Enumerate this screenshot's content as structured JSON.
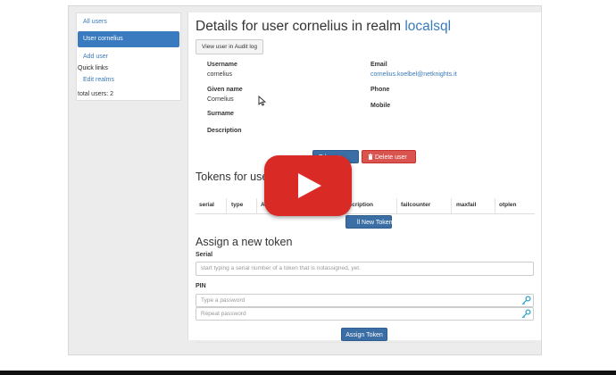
{
  "sidebar": {
    "all_users": "All users",
    "current_user": "User cornelius",
    "add_user": "Add user",
    "quick_links_title": "Quick links",
    "edit_realms": "Edit realms",
    "total_users": "total users: 2"
  },
  "header": {
    "title_prefix": "Details for user cornelius in realm",
    "realm": "localsql",
    "audit_button": "View user in Audit log"
  },
  "user_fields": {
    "username_label": "Username",
    "username_value": "cornelius",
    "email_label": "Email",
    "email_value": "cornelius.koelbel@netknights.it",
    "given_name_label": "Given name",
    "given_name_value": "Cornelius",
    "phone_label": "Phone",
    "mobile_label": "Mobile",
    "surname_label": "Surname",
    "description_label": "Description"
  },
  "actions": {
    "edit_user_partial": "Ed      user",
    "delete_user": "Delete   user"
  },
  "tokens": {
    "title": "Tokens for user",
    "columns": [
      "serial",
      "type",
      "A",
      "description",
      "failcounter",
      "maxfail",
      "otplen"
    ],
    "enroll_button": "ll New Token"
  },
  "assign": {
    "title": "Assign a new token",
    "serial_label": "Serial",
    "serial_placeholder": "start typing a serial number of a token that is notassigned, yet.",
    "pin_label": "PIN",
    "pin_placeholder": "Type a password",
    "repeat_placeholder": "Repeat password",
    "assign_button": "Assign Token"
  },
  "icons": {
    "key": "key-icon",
    "trash": "trash-icon",
    "play": "play-icon"
  },
  "colors": {
    "primary": "#3a6ea5",
    "danger": "#d9534f",
    "link": "#3a7ab8",
    "play_red": "#d92a26"
  }
}
